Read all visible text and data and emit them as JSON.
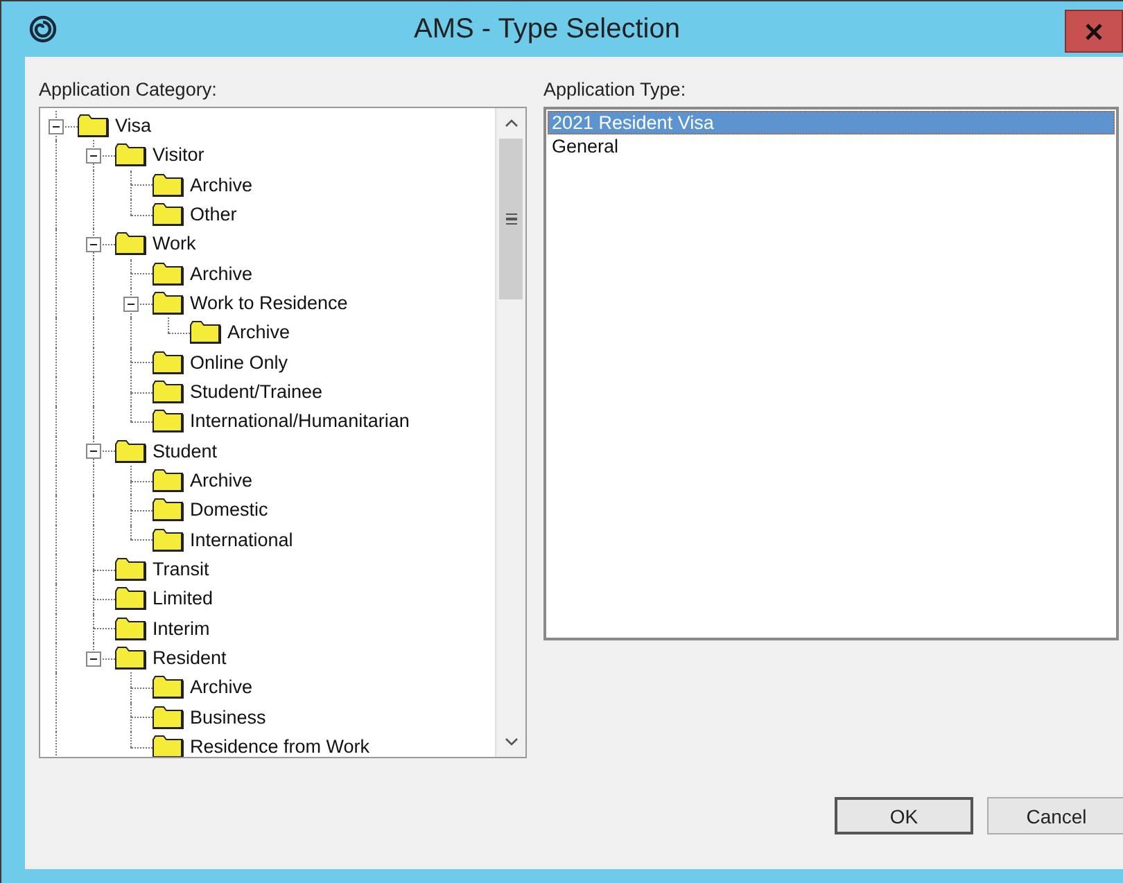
{
  "window": {
    "title": "AMS - Type Selection"
  },
  "category": {
    "label": "Application Category:",
    "tree": [
      {
        "label": "Visa",
        "expanded": true,
        "children": [
          {
            "label": "Visitor",
            "expanded": true,
            "children": [
              {
                "label": "Archive"
              },
              {
                "label": "Other"
              }
            ]
          },
          {
            "label": "Work",
            "expanded": true,
            "children": [
              {
                "label": "Archive"
              },
              {
                "label": "Work to Residence",
                "expanded": true,
                "children": [
                  {
                    "label": "Archive"
                  }
                ]
              },
              {
                "label": "Online Only"
              },
              {
                "label": "Student/Trainee"
              },
              {
                "label": "International/Humanitarian"
              }
            ]
          },
          {
            "label": "Student",
            "expanded": true,
            "children": [
              {
                "label": "Archive"
              },
              {
                "label": "Domestic"
              },
              {
                "label": "International"
              }
            ]
          },
          {
            "label": "Transit"
          },
          {
            "label": "Limited"
          },
          {
            "label": "Interim"
          },
          {
            "label": "Resident",
            "expanded": true,
            "children": [
              {
                "label": "Archive"
              },
              {
                "label": "Business"
              },
              {
                "label": "Residence from Work"
              }
            ]
          }
        ]
      }
    ]
  },
  "type": {
    "label": "Application Type:",
    "items": [
      {
        "label": "2021 Resident Visa",
        "selected": true
      },
      {
        "label": "General",
        "selected": false
      }
    ]
  },
  "buttons": [
    {
      "label": "OK",
      "kind": "default"
    },
    {
      "label": "Cancel",
      "kind": "normal"
    }
  ]
}
